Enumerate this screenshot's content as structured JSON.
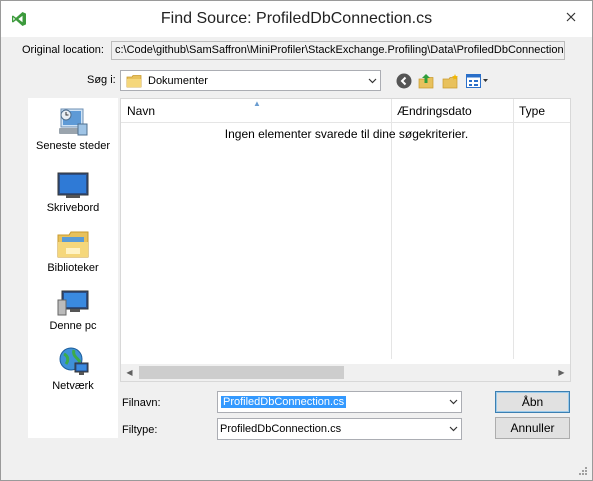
{
  "window": {
    "title": "Find Source: ProfiledDbConnection.cs",
    "close_icon": "close-icon"
  },
  "original_location": {
    "label": "Original location:",
    "value": "c:\\Code\\github\\SamSaffron\\MiniProfiler\\StackExchange.Profiling\\Data\\ProfiledDbConnection.cs"
  },
  "look_in": {
    "label": "Søg i:",
    "value": "Dokumenter"
  },
  "places": [
    {
      "label": "Seneste steder",
      "icon": "recent-places-icon"
    },
    {
      "label": "Skrivebord",
      "icon": "desktop-icon"
    },
    {
      "label": "Biblioteker",
      "icon": "libraries-icon"
    },
    {
      "label": "Denne pc",
      "icon": "this-pc-icon"
    },
    {
      "label": "Netværk",
      "icon": "network-icon"
    }
  ],
  "file_list": {
    "columns": [
      "Navn",
      "Ændringsdato",
      "Type"
    ],
    "empty_message": "Ingen elementer svarede til dine søgekriterier."
  },
  "filename": {
    "label": "Filnavn:",
    "value": "ProfiledDbConnection.cs"
  },
  "filetype": {
    "label": "Filtype:",
    "value": "ProfiledDbConnection.cs"
  },
  "buttons": {
    "open": "Åbn",
    "cancel": "Annuller"
  },
  "colors": {
    "selection": "#3399ff",
    "vs_purple": "#68217a"
  }
}
